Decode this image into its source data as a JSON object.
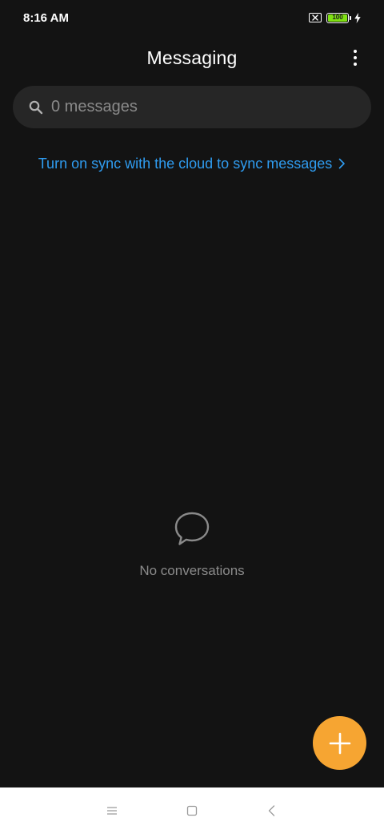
{
  "status_bar": {
    "time": "8:16 AM",
    "battery_level": "100",
    "icons": [
      "sim-missing-icon",
      "battery-icon",
      "charging-bolt-icon"
    ]
  },
  "header": {
    "title": "Messaging",
    "menu_icon": "more-vertical-icon"
  },
  "search": {
    "placeholder": "0 messages",
    "value": "",
    "icon": "search-icon"
  },
  "sync": {
    "link_text": "Turn on sync with the cloud to sync messages",
    "icon": "chevron-right-icon"
  },
  "empty_state": {
    "icon": "chat-bubble-icon",
    "text": "No conversations"
  },
  "fab": {
    "icon": "plus-icon"
  },
  "nav_bar": {
    "items": [
      "menu-icon",
      "home-square-icon",
      "back-icon"
    ]
  },
  "colors": {
    "background": "#131313",
    "search_background": "#262626",
    "accent_blue": "#2f9cf0",
    "fab_orange": "#f6a532",
    "muted_text": "#8a8a8a",
    "battery_green": "#7fe012",
    "nav_background": "#ffffff"
  }
}
